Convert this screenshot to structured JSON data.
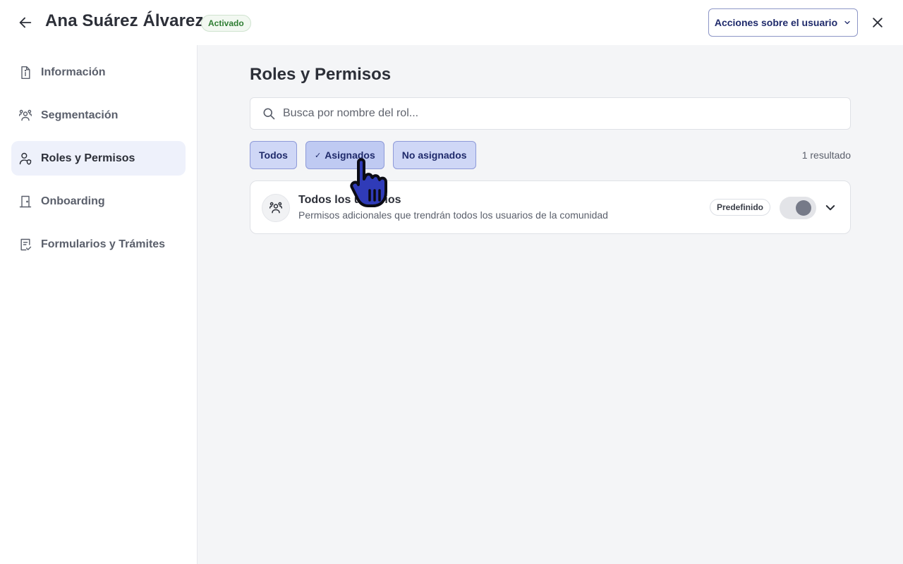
{
  "header": {
    "user_name": "Ana Suárez Álvarez",
    "status": "Activado",
    "actions_label": "Acciones sobre el usuario"
  },
  "sidebar": {
    "items": [
      {
        "label": "Información",
        "icon": "info-document-icon",
        "active": false
      },
      {
        "label": "Segmentación",
        "icon": "users-group-icon",
        "active": false
      },
      {
        "label": "Roles y Permisos",
        "icon": "user-shield-icon",
        "active": true
      },
      {
        "label": "Onboarding",
        "icon": "door-icon",
        "active": false
      },
      {
        "label": "Formularios y Trámites",
        "icon": "form-check-icon",
        "active": false
      }
    ]
  },
  "main": {
    "title": "Roles y Permisos",
    "search": {
      "placeholder": "Busca por nombre del rol...",
      "value": ""
    },
    "filters": [
      {
        "label": "Todos",
        "selected": false
      },
      {
        "label": "Asignados",
        "selected": true,
        "check": "✓"
      },
      {
        "label": "No asignados",
        "selected": false
      }
    ],
    "results": "1 resultado",
    "roles": [
      {
        "title": "Todos los usuarios",
        "description": "Permisos adicionales que trendrán todos los usuarios de la comunidad",
        "badge": "Predefinido",
        "enabled": true
      }
    ]
  },
  "colors": {
    "accent": "#1f2a6b",
    "chip_bg": "#cfd7f6",
    "active_nav_bg": "#eef1fb",
    "status_green": "#2e7d32",
    "main_bg": "#f4f5f7"
  }
}
